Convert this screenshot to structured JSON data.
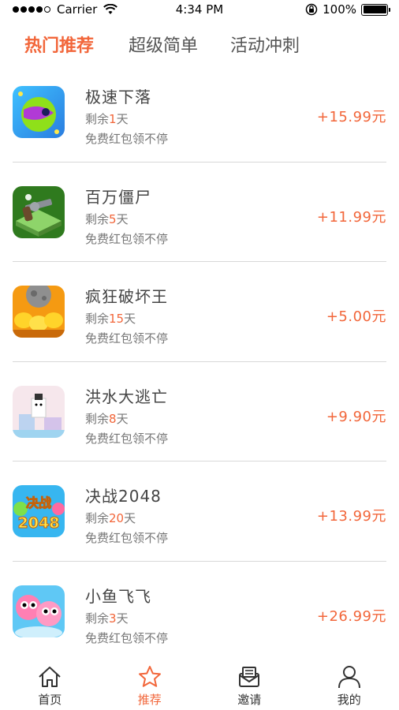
{
  "status_bar": {
    "carrier": "Carrier",
    "time": "4:34 PM",
    "battery": "100%",
    "battery_level": 1.0
  },
  "tabs": [
    {
      "label": "热门推荐",
      "active": true
    },
    {
      "label": "超级简单",
      "active": false
    },
    {
      "label": "活动冲刺",
      "active": false
    }
  ],
  "list": {
    "items": [
      {
        "name": "极速下落",
        "days_prefix": "剩余",
        "days": "1",
        "days_suffix": "天",
        "desc": "免费红包领不停",
        "price": "+15.99元",
        "icon": "ball-game-icon"
      },
      {
        "name": "百万僵尸",
        "days_prefix": "剩余",
        "days": "5",
        "days_suffix": "天",
        "desc": "免费红包领不停",
        "price": "+11.99元",
        "icon": "revolver-game-icon"
      },
      {
        "name": "疯狂破坏王",
        "days_prefix": "剩余",
        "days": "15",
        "days_suffix": "天",
        "desc": "免费红包领不停",
        "price": "+5.00元",
        "icon": "coins-game-icon"
      },
      {
        "name": "洪水大逃亡",
        "days_prefix": "剩余",
        "days": "8",
        "days_suffix": "天",
        "desc": "免费红包领不停",
        "price": "+9.90元",
        "icon": "flood-game-icon"
      },
      {
        "name": "决战2048",
        "days_prefix": "剩余",
        "days": "20",
        "days_suffix": "天",
        "desc": "免费红包领不停",
        "price": "+13.99元",
        "icon": "2048-game-icon",
        "icon_text_top": "决战",
        "icon_text_bottom": "2048"
      },
      {
        "name": "小鱼飞飞",
        "days_prefix": "剩余",
        "days": "3",
        "days_suffix": "天",
        "desc": "免费红包领不停",
        "price": "+26.99元",
        "icon": "fish-game-icon"
      }
    ]
  },
  "bottom_nav": [
    {
      "label": "首页",
      "icon": "home-icon",
      "active": false
    },
    {
      "label": "推荐",
      "icon": "star-icon",
      "active": true
    },
    {
      "label": "邀请",
      "icon": "envelope-icon",
      "active": false
    },
    {
      "label": "我的",
      "icon": "user-icon",
      "active": false
    }
  ],
  "colors": {
    "accent": "#f2663a",
    "divider": "#d8d8d8",
    "text": "#444444",
    "secondary_text": "#777777"
  }
}
